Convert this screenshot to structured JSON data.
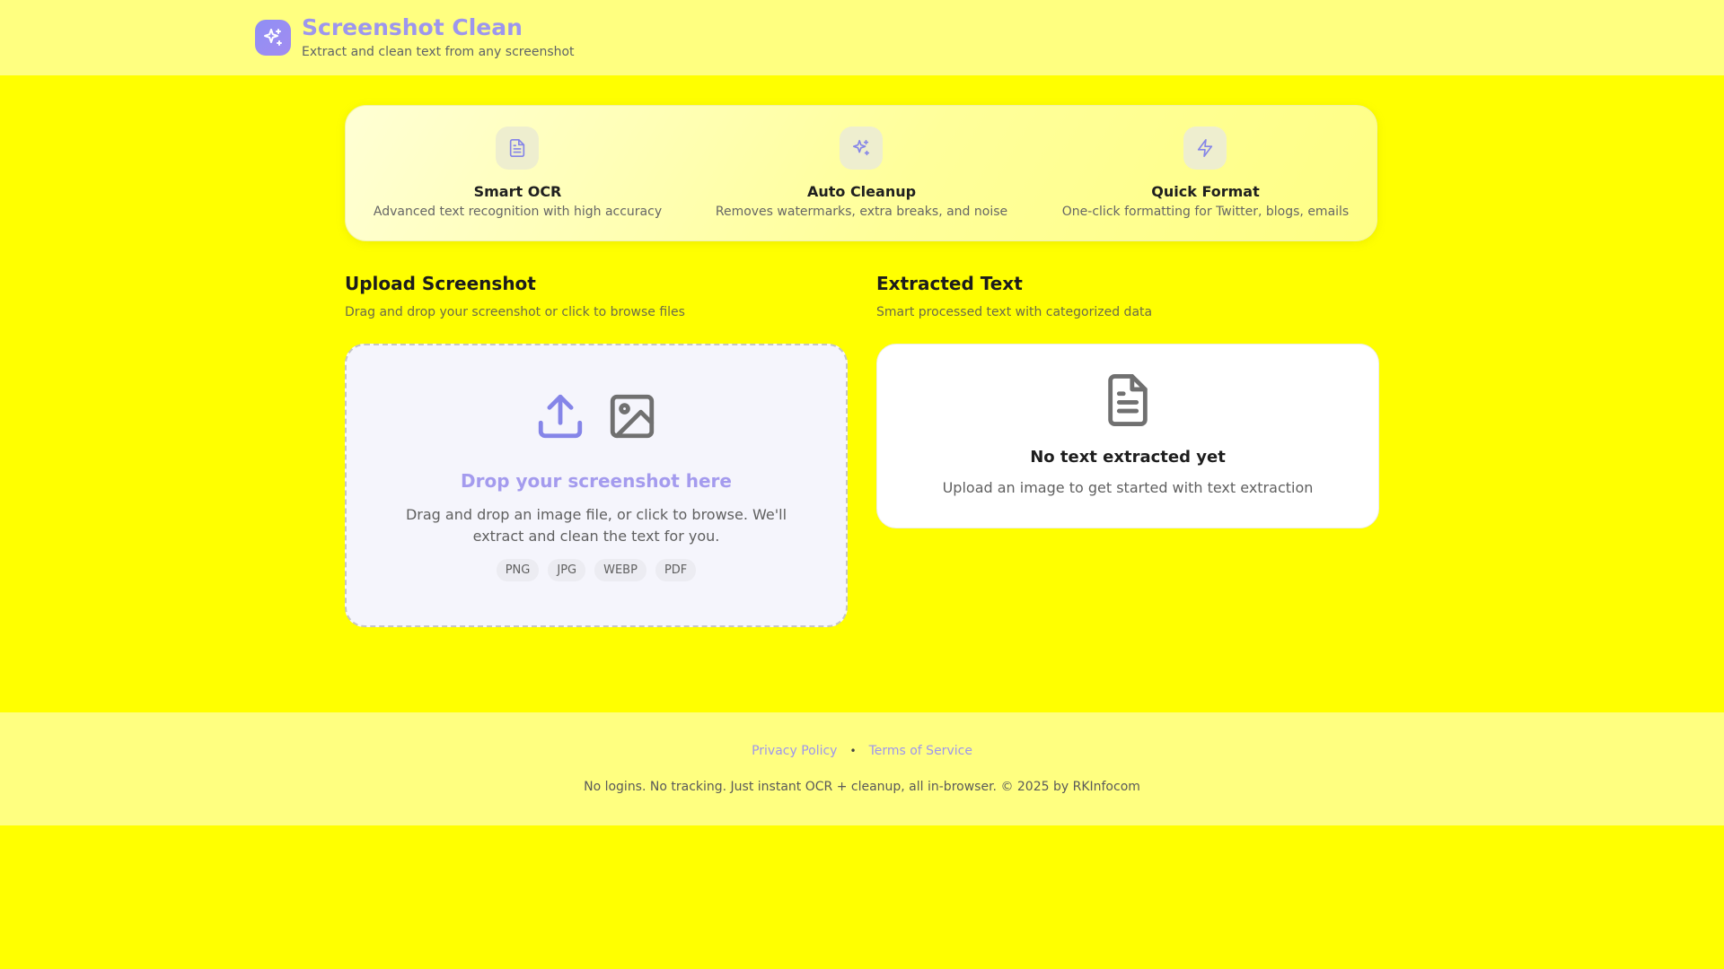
{
  "header": {
    "title": "Screenshot Clean",
    "subtitle": "Extract and clean text from any screenshot",
    "logo_icon": "sparkles-icon"
  },
  "features": [
    {
      "icon": "document-icon",
      "title": "Smart OCR",
      "description": "Advanced text recognition with high accuracy"
    },
    {
      "icon": "sparkles-icon",
      "title": "Auto Cleanup",
      "description": "Removes watermarks, extra breaks, and noise"
    },
    {
      "icon": "lightning-icon",
      "title": "Quick Format",
      "description": "One-click formatting for Twitter, blogs, emails"
    }
  ],
  "upload": {
    "title": "Upload Screenshot",
    "subtitle": "Drag and drop your screenshot or click to browse files",
    "drop_title": "Drop your screenshot here",
    "drop_description": "Drag and drop an image file, or click to browse. We'll extract and clean the text for you.",
    "formats": [
      "PNG",
      "JPG",
      "WEBP",
      "PDF"
    ]
  },
  "extracted": {
    "title": "Extracted Text",
    "subtitle": "Smart processed text with categorized data",
    "empty_title": "No text extracted yet",
    "empty_description": "Upload an image to get started with text extraction"
  },
  "footer": {
    "privacy_label": "Privacy Policy",
    "separator": "•",
    "terms_label": "Terms of Service",
    "note": "No logins. No tracking. Just instant OCR + cleanup, all in-browser. © 2025 by RKInfocom"
  },
  "colors": {
    "background": "#ffff00",
    "header_bg": "#ffff80",
    "accent": "#9d96ee",
    "icon_stroke": "#8585e8"
  }
}
